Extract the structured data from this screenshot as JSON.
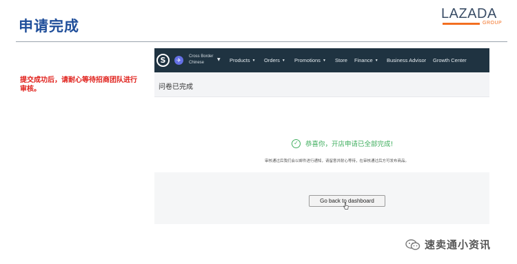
{
  "slide": {
    "title": "申请完成",
    "note": "提交成功后，请耐心等待招商团队进行审核。"
  },
  "logo": {
    "word": "LAZADA",
    "group": "GROUP"
  },
  "screenshot": {
    "brand_icon": "S",
    "account": {
      "line1": "Cross Border",
      "line2": "Chinese"
    },
    "nav": {
      "products": "Products",
      "orders": "Orders",
      "promotions": "Promotions",
      "store": "Store",
      "finance": "Finance",
      "business_advisor": "Business Advisor",
      "growth_center": "Growth Center"
    },
    "page_title": "问卷已完成",
    "success_message": "恭喜你，开店申请已全部完成!",
    "sub_message": "审核通过后我们会以邮件进行通知，请留意并耐心等待，在审核通过后方可发布商品。",
    "dashboard_button": "Go back to dashboard"
  },
  "watermark": {
    "account_name": "速卖通小资讯"
  },
  "colors": {
    "title_blue": "#1f4e9a",
    "note_red": "#e0201b",
    "navbar": "#1f3341",
    "success_green": "#3fae5e",
    "logo_orange": "#f36f21"
  },
  "icons": [
    "brand-s-icon",
    "airplane-icon",
    "caret-down-icon",
    "check-circle-icon",
    "pointer-cursor-icon",
    "wechat-icon"
  ]
}
